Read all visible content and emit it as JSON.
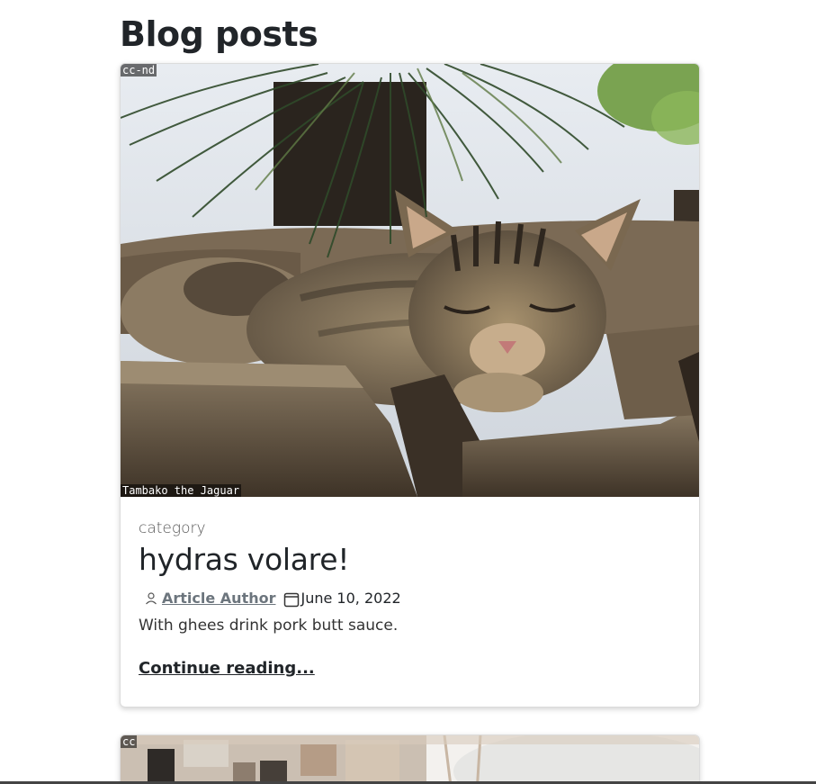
{
  "page": {
    "title": "Blog posts"
  },
  "posts": [
    {
      "image_license": "cc-nd",
      "image_credit": "Tambako the Jaguar",
      "category": "category",
      "title": "hydras volare!",
      "author": "Article Author",
      "date": "June 10, 2022",
      "excerpt": "With ghees drink pork butt sauce.",
      "continue_label": "Continue reading..."
    },
    {
      "image_license": "cc"
    }
  ],
  "icons": {
    "author": "person-icon",
    "date": "calendar-icon"
  },
  "colors": {
    "author_link": "#6c757d",
    "text": "#212529"
  }
}
